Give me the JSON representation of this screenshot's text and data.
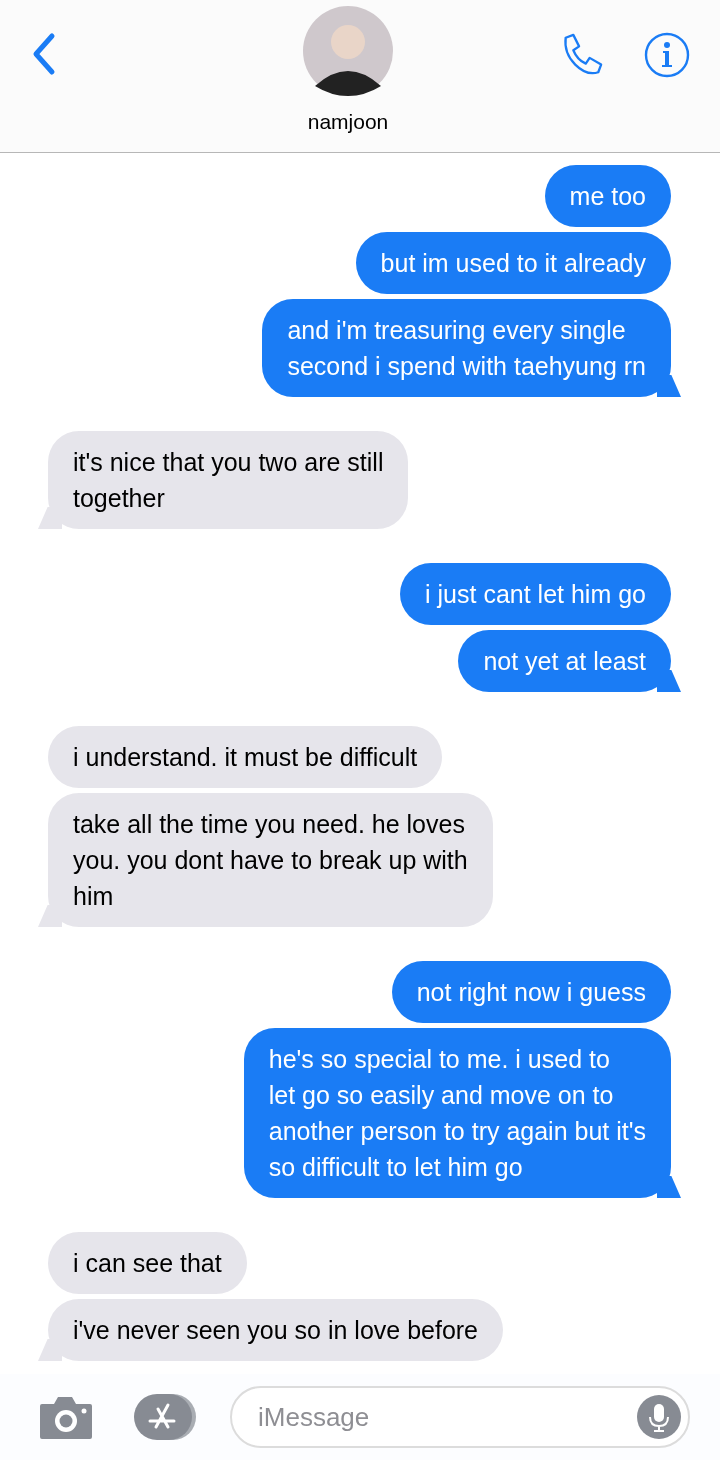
{
  "contact": {
    "name": "namjoon"
  },
  "messages": [
    {
      "kind": "sent",
      "text": "me too",
      "tail": false
    },
    {
      "kind": "sent",
      "text": "but im used to it already",
      "tail": false
    },
    {
      "kind": "sent",
      "text": "and i'm treasuring every single\nsecond i spend with taehyung rn",
      "tail": true
    },
    {
      "kind": "received",
      "text": "it's nice that you two are still\ntogether",
      "tail": true
    },
    {
      "kind": "sent",
      "text": "i just cant let him go",
      "tail": false
    },
    {
      "kind": "sent",
      "text": "not yet at least",
      "tail": true
    },
    {
      "kind": "received",
      "text": "i understand. it must be difficult",
      "tail": false
    },
    {
      "kind": "received",
      "text": "take all the time you need. he loves\nyou. you dont have to break up with\nhim",
      "tail": true
    },
    {
      "kind": "sent",
      "text": "not right now i guess",
      "tail": false
    },
    {
      "kind": "sent",
      "text": "he's so special to me. i used to\nlet go so easily and move on to\nanother person to try again but it's\nso difficult to let him go",
      "tail": true
    },
    {
      "kind": "received",
      "text": "i can see that",
      "tail": false
    },
    {
      "kind": "received",
      "text": "i've never seen you so in love before",
      "tail": true
    }
  ],
  "composer": {
    "placeholder": "iMessage"
  }
}
